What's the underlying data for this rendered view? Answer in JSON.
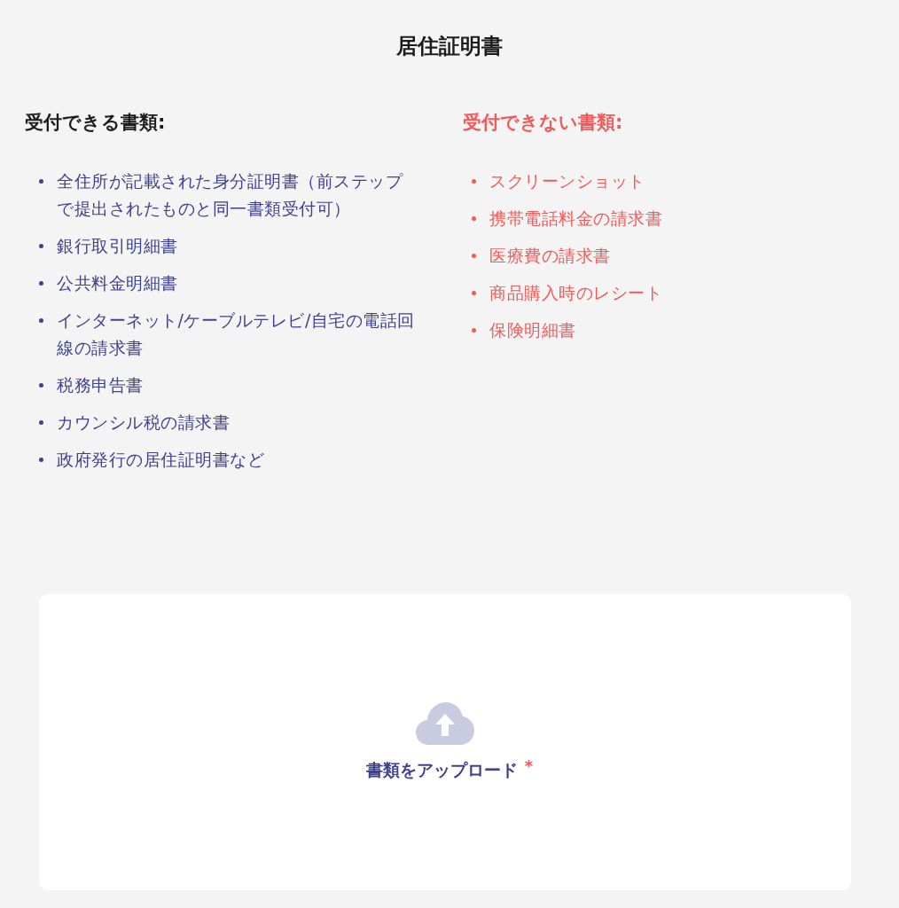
{
  "title": "居住証明書",
  "accepted": {
    "heading": "受付できる書類:",
    "items": [
      "全住所が記載された身分証明書（前ステップで提出されたものと同一書類受付可）",
      "銀行取引明細書",
      "公共料金明細書",
      "インターネット/ケーブルテレビ/自宅の電話回線の請求書",
      "税務申告書",
      "カウンシル税の請求書",
      "政府発行の居住証明書など"
    ]
  },
  "rejected": {
    "heading": "受付できない書類:",
    "items": [
      "スクリーンショット",
      "携帯電話料金の請求書",
      "医療費の請求書",
      "商品購入時のレシート",
      "保険明細書"
    ]
  },
  "upload": {
    "label": "書類をアップロード",
    "required_mark": "*"
  }
}
